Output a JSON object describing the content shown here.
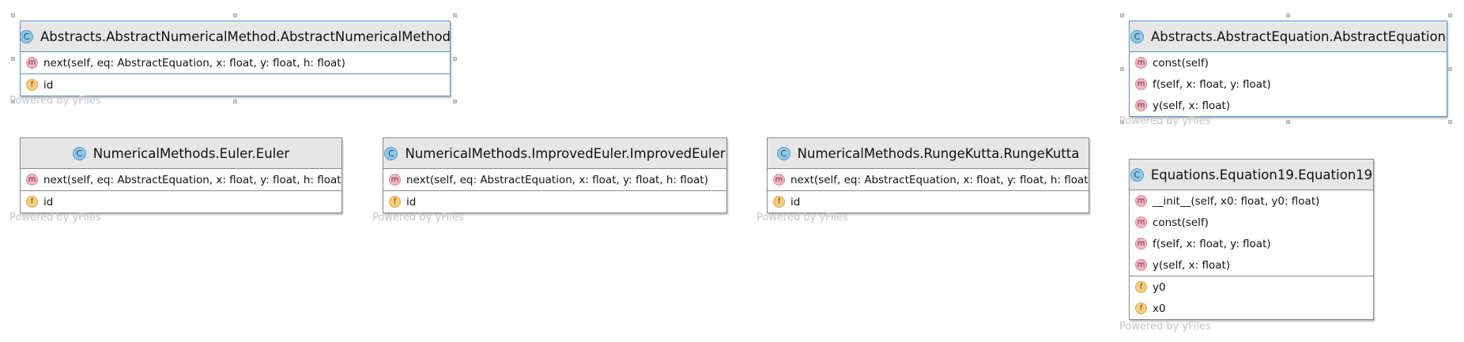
{
  "watermark_text": "Powered by yFiles",
  "classes": [
    {
      "id": "abstract-numerical-method",
      "title": "Abstracts.AbstractNumericalMethod.AbstractNumericalMethod",
      "kind_icon": "class-c-icon",
      "selected": true,
      "methods": [
        "next(self, eq: AbstractEquation, x: float, y: float, h: float)"
      ],
      "fields": [
        "id"
      ]
    },
    {
      "id": "abstract-equation",
      "title": "Abstracts.AbstractEquation.AbstractEquation",
      "kind_icon": "class-c-icon",
      "selected": true,
      "methods": [
        "const(self)",
        "f(self, x: float, y: float)",
        "y(self, x: float)"
      ],
      "fields": []
    },
    {
      "id": "euler",
      "title": "NumericalMethods.Euler.Euler",
      "kind_icon": "class-c-icon",
      "selected": false,
      "methods": [
        "next(self, eq: AbstractEquation, x: float, y: float, h: float)"
      ],
      "fields": [
        "id"
      ]
    },
    {
      "id": "improved-euler",
      "title": "NumericalMethods.ImprovedEuler.ImprovedEuler",
      "kind_icon": "class-c-icon",
      "selected": false,
      "methods": [
        "next(self, eq: AbstractEquation, x: float, y: float, h: float)"
      ],
      "fields": [
        "id"
      ]
    },
    {
      "id": "runge-kutta",
      "title": "NumericalMethods.RungeKutta.RungeKutta",
      "kind_icon": "class-c-icon",
      "selected": false,
      "methods": [
        "next(self, eq: AbstractEquation, x: float, y: float, h: float)"
      ],
      "fields": [
        "id"
      ]
    },
    {
      "id": "equation19",
      "title": "Equations.Equation19.Equation19",
      "kind_icon": "class-c-icon",
      "selected": false,
      "methods": [
        "__init__(self, x0: float, y0: float)",
        "const(self)",
        "f(self, x: float, y: float)",
        "y(self, x: float)"
      ],
      "fields": [
        "y0",
        "x0"
      ]
    }
  ],
  "badge_letters": {
    "class": "C",
    "method": "m",
    "field": "f"
  },
  "colors": {
    "header_bg": "#e6e6e6",
    "border": "#8a8a8a",
    "selected_border": "#5b8fc9",
    "class_badge": "#8fc7e6",
    "method_badge": "#f0b7c2",
    "field_badge": "#f5cd7d",
    "watermark": "#c4c4c4"
  }
}
